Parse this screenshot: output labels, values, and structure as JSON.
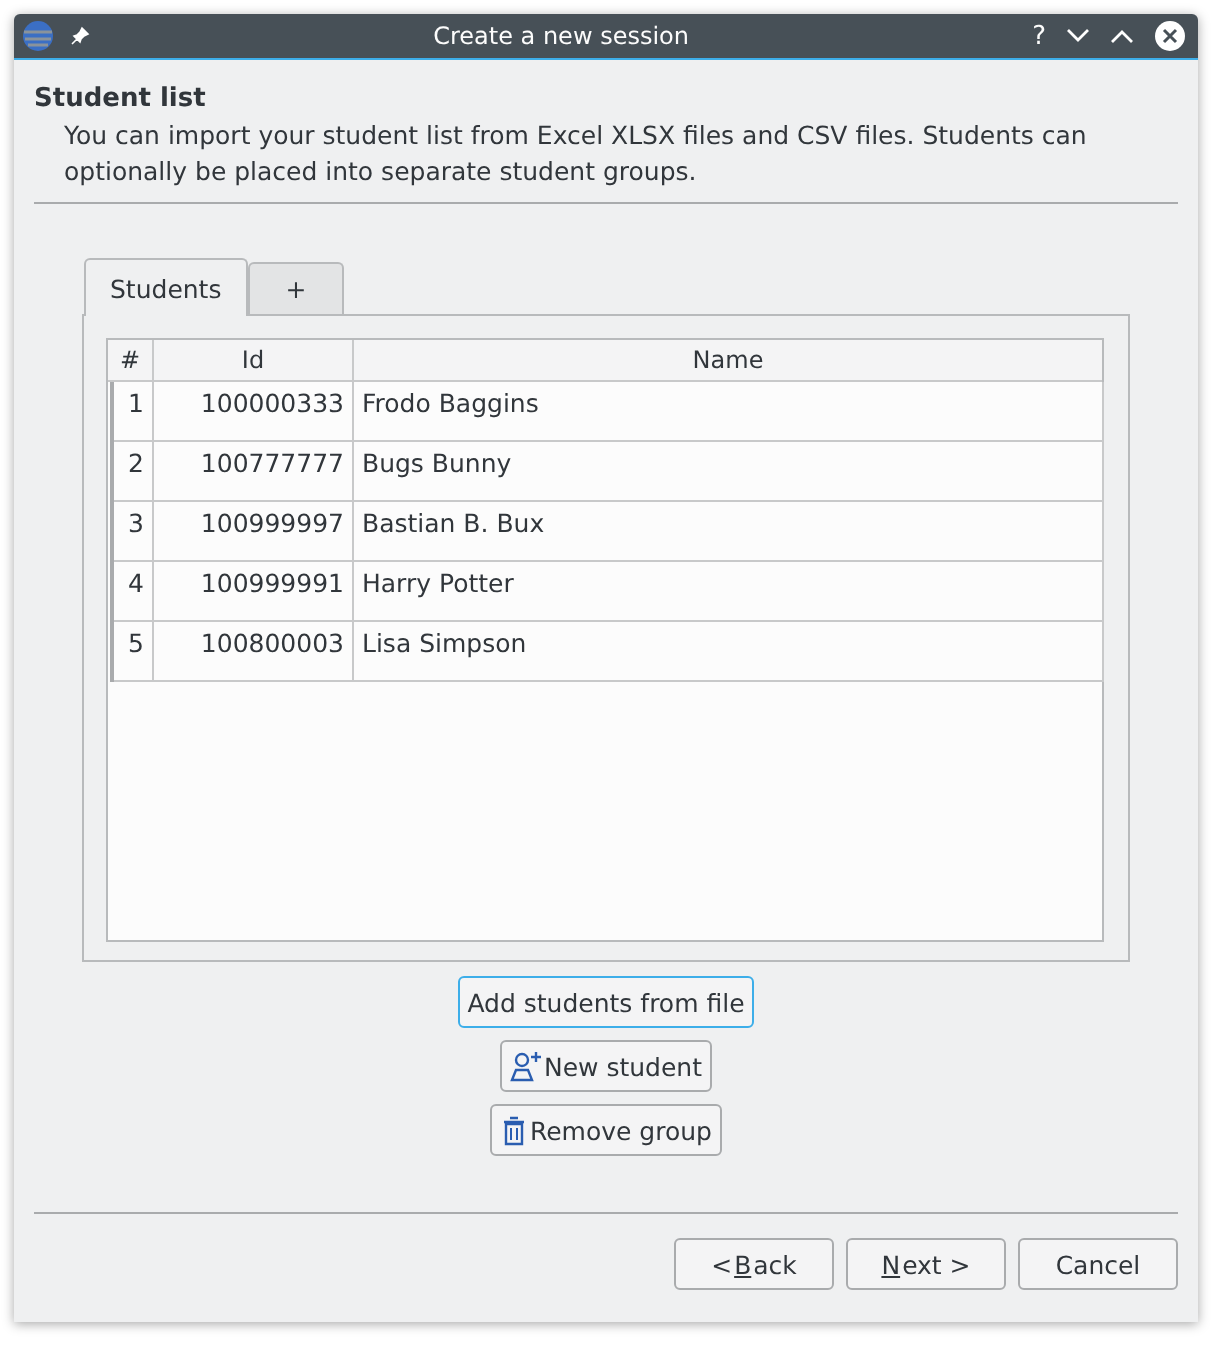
{
  "window": {
    "title": "Create a new session",
    "controls": [
      "?"
    ]
  },
  "header": {
    "title": "Student list",
    "description": "You can import your student list from Excel XLSX files and CSV files. Students can optionally be placed into separate student groups."
  },
  "tabs": [
    {
      "label": "Students",
      "selected": true
    },
    {
      "label": "+",
      "selected": false
    }
  ],
  "table": {
    "columns": [
      "#",
      "Id",
      "Name"
    ],
    "rows": [
      [
        "1",
        "100000333",
        "Frodo Baggins"
      ],
      [
        "2",
        "100777777",
        "Bugs Bunny"
      ],
      [
        "3",
        "100999997",
        "Bastian B. Bux"
      ],
      [
        "4",
        "100999991",
        "Harry Potter"
      ],
      [
        "5",
        "100800003",
        "Lisa Simpson"
      ]
    ]
  },
  "actions": [
    {
      "label": "Add students from file",
      "kind": "plain",
      "focused": true
    },
    {
      "label": "New student",
      "kind": "person",
      "focused": false
    },
    {
      "label": "Remove group",
      "kind": "trash",
      "focused": false
    }
  ],
  "buttons": [
    {
      "before": "< ",
      "key": "B",
      "after": "ack"
    },
    {
      "key": "N",
      "after": "ext >"
    },
    {
      "before": "Cancel"
    }
  ]
}
